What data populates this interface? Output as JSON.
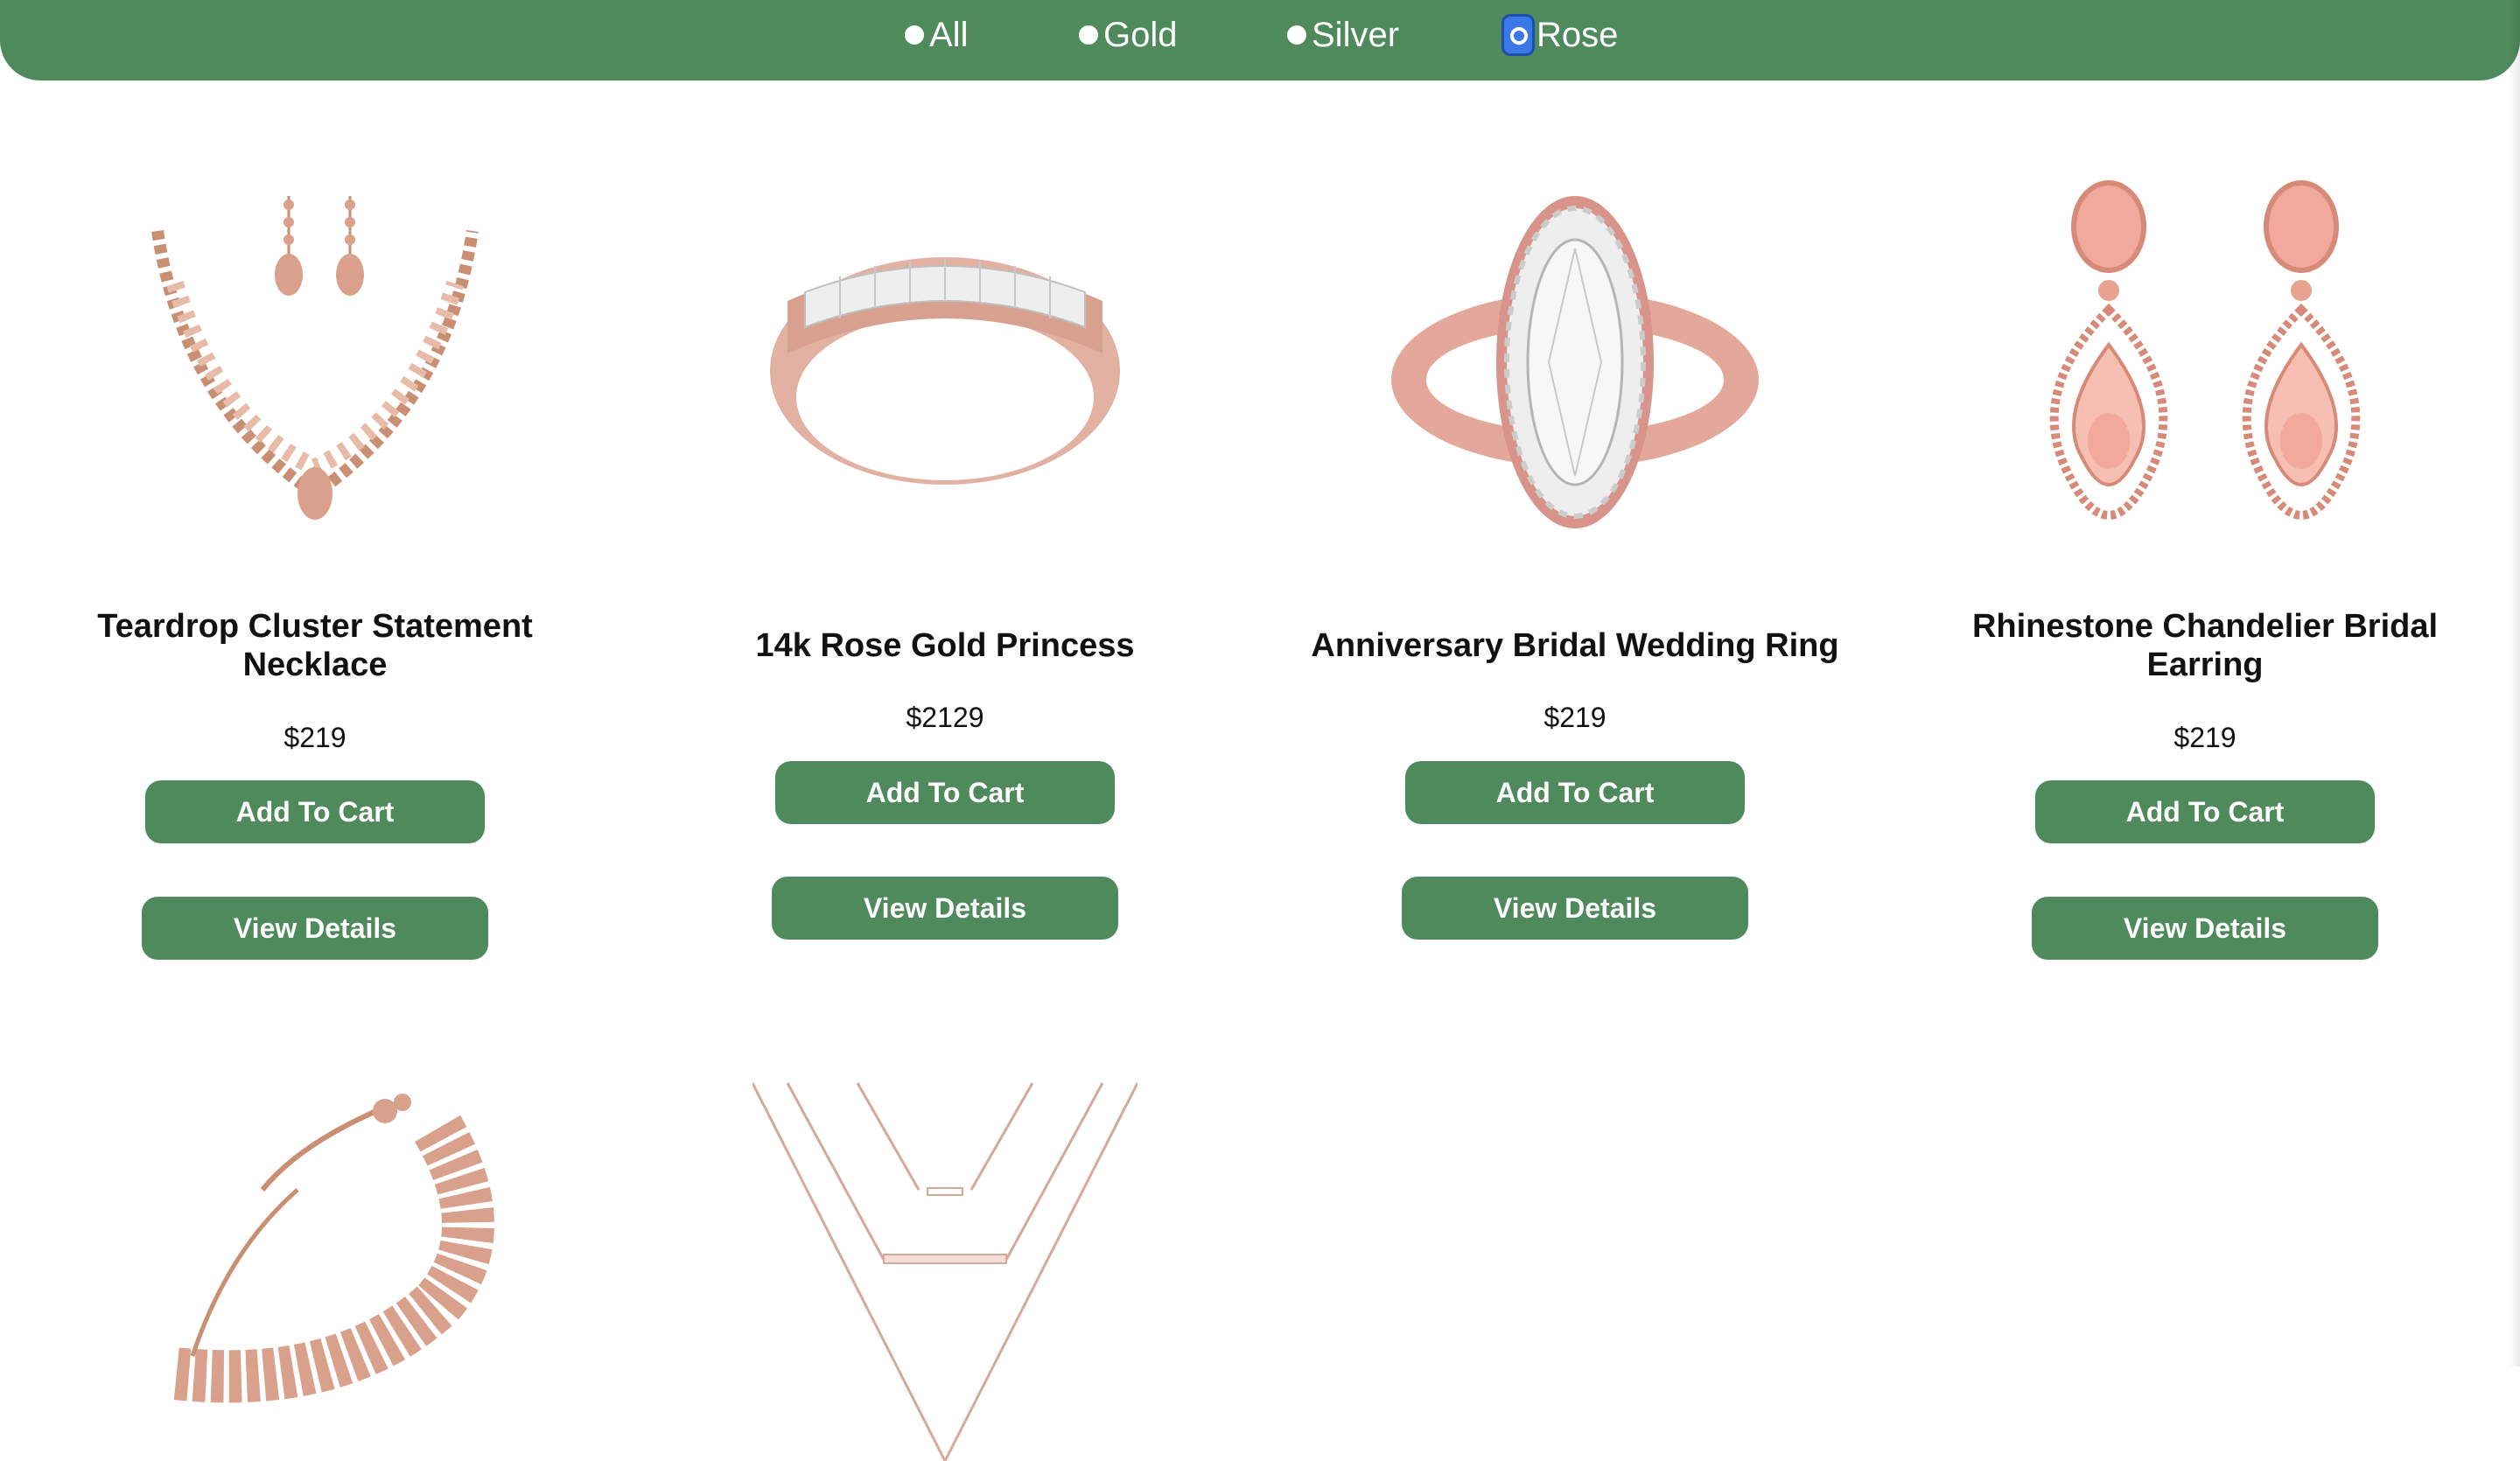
{
  "filters": [
    {
      "label": "All",
      "selected": false
    },
    {
      "label": "Gold",
      "selected": false
    },
    {
      "label": "Silver",
      "selected": false
    },
    {
      "label": "Rose",
      "selected": true
    }
  ],
  "colors": {
    "accent": "#4f8a5c",
    "rose_metal": "#d9a08c",
    "selected_radio": "#3b78e7"
  },
  "products": [
    {
      "name": "Teardrop Cluster Statement Necklace",
      "price": "$219",
      "cart_label": "Add To Cart",
      "details_label": "View Details",
      "image": "rose-gold-necklace-with-teardrop-earrings"
    },
    {
      "name": "14k Rose Gold Princess",
      "price": "$2129",
      "cart_label": "Add To Cart",
      "details_label": "View Details",
      "image": "rose-gold-band-ring"
    },
    {
      "name": "Anniversary Bridal Wedding Ring",
      "price": "$219",
      "cart_label": "Add To Cart",
      "details_label": "View Details",
      "image": "rose-gold-oval-diamond-ring"
    },
    {
      "name": "Rhinestone Chandelier Bridal Earring",
      "price": "$219",
      "cart_label": "Add To Cart",
      "details_label": "View Details",
      "image": "rose-gold-chandelier-earrings"
    },
    {
      "name": "",
      "price": "",
      "image": "rose-gold-byzantine-bracelet"
    },
    {
      "name": "",
      "price": "",
      "image": "rose-gold-layered-necklace"
    }
  ]
}
